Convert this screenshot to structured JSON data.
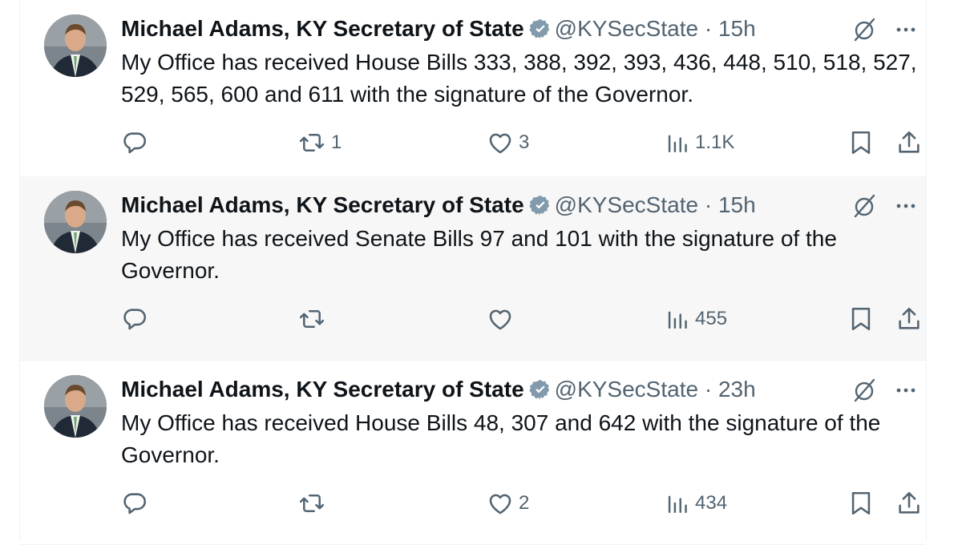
{
  "tweets": [
    {
      "name": "Michael Adams, KY Secretary of State",
      "handle": "@KYSecState",
      "separator": "·",
      "time": "15h",
      "text": "My Office has received House Bills 333, 388, 392, 393, 436, 448, 510, 518, 527, 529, 565, 600 and 611 with the signature of the Governor.",
      "replies": "",
      "retweets": "1",
      "likes": "3",
      "views": "1.1K"
    },
    {
      "name": "Michael Adams, KY Secretary of State",
      "handle": "@KYSecState",
      "separator": "·",
      "time": "15h",
      "text": "My Office has received Senate Bills 97 and 101 with the signature of the Governor.",
      "replies": "",
      "retweets": "",
      "likes": "",
      "views": "455"
    },
    {
      "name": "Michael Adams, KY Secretary of State",
      "handle": "@KYSecState",
      "separator": "·",
      "time": "23h",
      "text": "My Office has received House Bills 48, 307 and 642 with the signature of the Governor.",
      "replies": "",
      "retweets": "",
      "likes": "2",
      "views": "434"
    }
  ],
  "icons": {
    "reply": "reply-icon",
    "retweet": "retweet-icon",
    "like": "heart-icon",
    "views": "views-icon",
    "bookmark": "bookmark-icon",
    "share": "share-icon",
    "grok": "grok-icon",
    "more": "more-icon",
    "verified": "verified-badge-icon"
  },
  "colors": {
    "text": "#0f1419",
    "secondary": "#536471",
    "verified": "#829aab",
    "hover_bg": "#f7f7f7"
  }
}
